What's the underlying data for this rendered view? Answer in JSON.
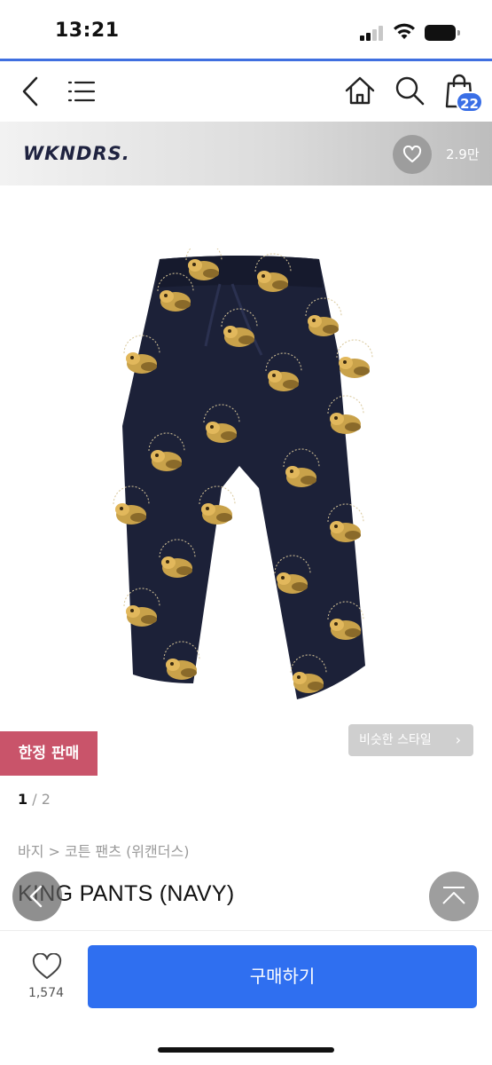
{
  "status_bar": {
    "time": "13:21"
  },
  "nav": {
    "back_icon": "chevron-left-icon",
    "menu_icon": "hamburger-icon",
    "home_icon": "home-icon",
    "search_icon": "search-icon",
    "cart_icon": "shopping-bag-icon",
    "cart_count": "22"
  },
  "brand": {
    "name": "WKNDRS.",
    "like_count": "2.9만"
  },
  "product": {
    "limited_badge": "한정 판매",
    "similar_style": "비슷한 스타일",
    "page_current": "1",
    "page_separator": " / ",
    "page_total": "2",
    "breadcrumb": "바지 > 코튼 팬츠 (위캔더스)",
    "title": "KING PANTS (NAVY)"
  },
  "bottom_bar": {
    "wish_count": "1,574",
    "buy_label": "구매하기"
  },
  "colors": {
    "accent_blue": "#2f6ff0",
    "badge_pink": "#c9546a",
    "product_navy": "#1c2138"
  }
}
